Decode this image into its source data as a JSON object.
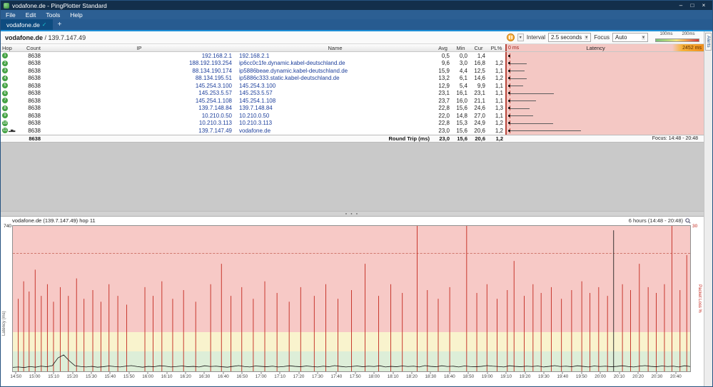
{
  "colors": {
    "titlebar": "#132f4b",
    "menubar": "#2c5f93",
    "tabactive": "#0e4c80",
    "accent": "#1d8fd7",
    "orange": "#f49c20",
    "badge": "#44a244",
    "link": "#1d3f9b",
    "pink": "#f4c8c4",
    "bandred": "#f7c9c6",
    "bandyellow": "#f9f3cd",
    "bandgreen": "#ddeed8",
    "spike": "#c2271d"
  },
  "window": {
    "title": "vodafone.de - PingPlotter Standard",
    "controls": {
      "minimize": "–",
      "maximize": "□",
      "close": "×"
    }
  },
  "menu": {
    "items": [
      "File",
      "Edit",
      "Tools",
      "Help"
    ]
  },
  "tabs": {
    "active_label": "vodafone.de",
    "check_icon": "✓",
    "new_tab_label": "+"
  },
  "target_bar": {
    "target": "vodafone.de",
    "separator": " / ",
    "ip": "139.7.147.49",
    "interval_label": "Interval",
    "interval_value": "2.5 seconds",
    "focus_label": "Focus",
    "focus_value": "Auto",
    "dropdown_arrow": "▾",
    "legend_labels": [
      "100ms",
      "200ms"
    ]
  },
  "rail": {
    "alerts_label": "Alerts"
  },
  "table": {
    "headers": {
      "hop": "Hop",
      "count": "Count",
      "ip": "IP",
      "name": "Name",
      "avg": "Avg",
      "min": "Min",
      "cur": "Cur",
      "pl": "PL%"
    },
    "latency_header": {
      "zero": "0 ms",
      "title": "Latency",
      "max": "2452 ms"
    },
    "latency_scale_max": 2452,
    "rows": [
      {
        "hop": "1",
        "count": "8638",
        "ip": "192.168.2.1",
        "name": "192.168.2.1",
        "avg": "0,5",
        "min": "0,0",
        "cur": "1,4",
        "pl": "",
        "max_ms": 40,
        "graphed": false
      },
      {
        "hop": "2",
        "count": "8638",
        "ip": "188.192.193.254",
        "name": "ip6cc0c1fe.dynamic.kabel-deutschland.de",
        "avg": "9,6",
        "min": "3,0",
        "cur": "16,8",
        "pl": "1,2",
        "max_ms": 245,
        "graphed": false
      },
      {
        "hop": "3",
        "count": "8638",
        "ip": "88.134.190.174",
        "name": "ip5886beae.dynamic.kabel-deutschland.de",
        "avg": "15,9",
        "min": "4,4",
        "cur": "12,5",
        "pl": "1,1",
        "max_ms": 225,
        "graphed": false
      },
      {
        "hop": "4",
        "count": "8638",
        "ip": "88.134.195.51",
        "name": "ip5886c333.static.kabel-deutschland.de",
        "avg": "13,2",
        "min": "6,1",
        "cur": "14,6",
        "pl": "1,2",
        "max_ms": 245,
        "graphed": false
      },
      {
        "hop": "5",
        "count": "8638",
        "ip": "145.254.3.100",
        "name": "145.254.3.100",
        "avg": "12,9",
        "min": "5,4",
        "cur": "9,9",
        "pl": "1,1",
        "max_ms": 205,
        "graphed": false
      },
      {
        "hop": "6",
        "count": "8638",
        "ip": "145.253.5.57",
        "name": "145.253.5.57",
        "avg": "23,1",
        "min": "16,1",
        "cur": "23,1",
        "pl": "1,1",
        "max_ms": 590,
        "graphed": false
      },
      {
        "hop": "7",
        "count": "8638",
        "ip": "145.254.1.108",
        "name": "145.254.1.108",
        "avg": "23,7",
        "min": "16,0",
        "cur": "21,1",
        "pl": "1,1",
        "max_ms": 360,
        "graphed": false
      },
      {
        "hop": "8",
        "count": "8638",
        "ip": "139.7.148.84",
        "name": "139.7.148.84",
        "avg": "22,8",
        "min": "15,6",
        "cur": "24,6",
        "pl": "1,3",
        "max_ms": 285,
        "graphed": false
      },
      {
        "hop": "9",
        "count": "8638",
        "ip": "10.210.0.50",
        "name": "10.210.0.50",
        "avg": "22,0",
        "min": "14,8",
        "cur": "27,0",
        "pl": "1,1",
        "max_ms": 325,
        "graphed": false
      },
      {
        "hop": "10",
        "count": "8638",
        "ip": "10.210.3.113",
        "name": "10.210.3.113",
        "avg": "22,8",
        "min": "15,3",
        "cur": "24,9",
        "pl": "1,2",
        "max_ms": 580,
        "graphed": false
      },
      {
        "hop": "11",
        "count": "8638",
        "ip": "139.7.147.49",
        "name": "vodafone.de",
        "avg": "23,0",
        "min": "15,6",
        "cur": "20,6",
        "pl": "1,2",
        "max_ms": 920,
        "graphed": true
      }
    ],
    "summary": {
      "count": "8638",
      "label": "Round Trip (ms)",
      "avg": "23,0",
      "min": "15,6",
      "cur": "20,6",
      "pl": "1,2",
      "focus": "Focus: 14:48 - 20:48"
    }
  },
  "splitter": {
    "grip_icon": "● ● ●"
  },
  "timeline": {
    "title": "vodafone.de (139.7.147.49) hop 11",
    "range_label": "6 hours (14:48 - 20:48)",
    "y_left_max": "740",
    "y_right_max": "30",
    "left_axis_label": "Latency (ms)",
    "right_axis_label": "Packet Loss %",
    "y_max": 740,
    "pl_max": 30,
    "thresholds": {
      "green_max": 100,
      "yellow_max": 200
    },
    "dashed_line_ms": 600,
    "x_total_min": 360,
    "x_start_min": 2,
    "x_step_min": 10,
    "x_ticks": [
      "14:50",
      "15:00",
      "15:10",
      "15:20",
      "15:30",
      "15:40",
      "15:50",
      "16:00",
      "16:10",
      "16:20",
      "16:30",
      "16:40",
      "16:50",
      "17:00",
      "17:10",
      "17:20",
      "17:30",
      "17:40",
      "17:50",
      "18:00",
      "18:10",
      "18:20",
      "18:30",
      "18:40",
      "18:50",
      "19:00",
      "19:10",
      "19:20",
      "19:30",
      "19:40",
      "19:50",
      "20:00",
      "20:10",
      "20:20",
      "20:30",
      "20:40"
    ],
    "spikes": [
      [
        0.008,
        0.5
      ],
      [
        0.016,
        0.62
      ],
      [
        0.024,
        0.55
      ],
      [
        0.033,
        0.7
      ],
      [
        0.042,
        0.52
      ],
      [
        0.051,
        0.6
      ],
      [
        0.06,
        0.48
      ],
      [
        0.07,
        0.58
      ],
      [
        0.082,
        0.52
      ],
      [
        0.094,
        0.64
      ],
      [
        0.105,
        0.5
      ],
      [
        0.118,
        0.56
      ],
      [
        0.13,
        0.48
      ],
      [
        0.142,
        0.6
      ],
      [
        0.155,
        0.52
      ],
      [
        0.168,
        0.46
      ],
      [
        0.195,
        0.58
      ],
      [
        0.207,
        0.52
      ],
      [
        0.22,
        0.62
      ],
      [
        0.236,
        0.5
      ],
      [
        0.252,
        0.56
      ],
      [
        0.27,
        0.48
      ],
      [
        0.292,
        0.6
      ],
      [
        0.308,
        0.74
      ],
      [
        0.322,
        0.52
      ],
      [
        0.338,
        0.58
      ],
      [
        0.355,
        0.5
      ],
      [
        0.372,
        0.62
      ],
      [
        0.39,
        0.54
      ],
      [
        0.408,
        0.48
      ],
      [
        0.425,
        0.58
      ],
      [
        0.445,
        0.52
      ],
      [
        0.462,
        0.6
      ],
      [
        0.48,
        0.5
      ],
      [
        0.5,
        0.56
      ],
      [
        0.52,
        0.74
      ],
      [
        0.54,
        0.52
      ],
      [
        0.558,
        0.6
      ],
      [
        0.575,
        0.54
      ],
      [
        0.597,
        1.0
      ],
      [
        0.612,
        0.56
      ],
      [
        0.628,
        0.5
      ],
      [
        0.645,
        0.58
      ],
      [
        0.67,
        1.0
      ],
      [
        0.685,
        0.54
      ],
      [
        0.7,
        0.6
      ],
      [
        0.715,
        0.5
      ],
      [
        0.73,
        0.56
      ],
      [
        0.74,
        0.76
      ],
      [
        0.755,
        0.52
      ],
      [
        0.768,
        0.6
      ],
      [
        0.78,
        0.54
      ],
      [
        0.795,
        0.58
      ],
      [
        0.81,
        0.5
      ],
      [
        0.825,
        0.56
      ],
      [
        0.84,
        0.62
      ],
      [
        0.852,
        0.54
      ],
      [
        0.865,
        0.58
      ],
      [
        0.878,
        0.52
      ],
      [
        0.9,
        0.6
      ],
      [
        0.912,
        0.56
      ],
      [
        0.925,
        0.74
      ],
      [
        0.938,
        0.58
      ],
      [
        0.95,
        0.54
      ],
      [
        0.962,
        0.6
      ],
      [
        0.973,
        1.0
      ],
      [
        0.985,
        0.56
      ],
      [
        0.995,
        0.8
      ]
    ],
    "dark_spikes": [
      [
        0.887,
        0.97
      ]
    ],
    "latency_series": [
      22,
      24,
      21,
      26,
      23,
      28,
      25,
      31,
      70,
      85,
      55,
      30,
      26,
      24,
      27,
      23,
      25,
      29,
      26,
      24,
      28,
      31,
      26,
      23,
      27,
      25,
      30,
      28,
      24,
      26,
      29,
      25,
      27,
      24,
      30,
      26,
      28,
      25,
      23,
      27,
      31,
      26,
      24,
      29,
      27,
      25,
      28,
      24,
      26,
      30,
      27,
      25,
      29,
      26,
      24,
      28,
      25,
      31,
      27,
      24,
      26,
      29,
      25,
      28,
      26,
      30,
      24,
      27,
      25,
      29,
      26,
      28,
      24,
      31,
      27,
      25,
      30,
      26,
      28,
      24,
      29,
      26,
      25,
      27,
      31,
      28,
      26,
      24,
      30,
      27,
      25,
      28,
      26,
      29,
      24,
      27,
      31,
      26,
      28,
      25,
      30,
      27,
      24,
      29,
      26,
      28,
      25,
      27,
      30,
      26,
      24,
      28,
      31,
      27,
      25,
      29,
      26,
      28,
      24,
      30,
      26
    ]
  }
}
